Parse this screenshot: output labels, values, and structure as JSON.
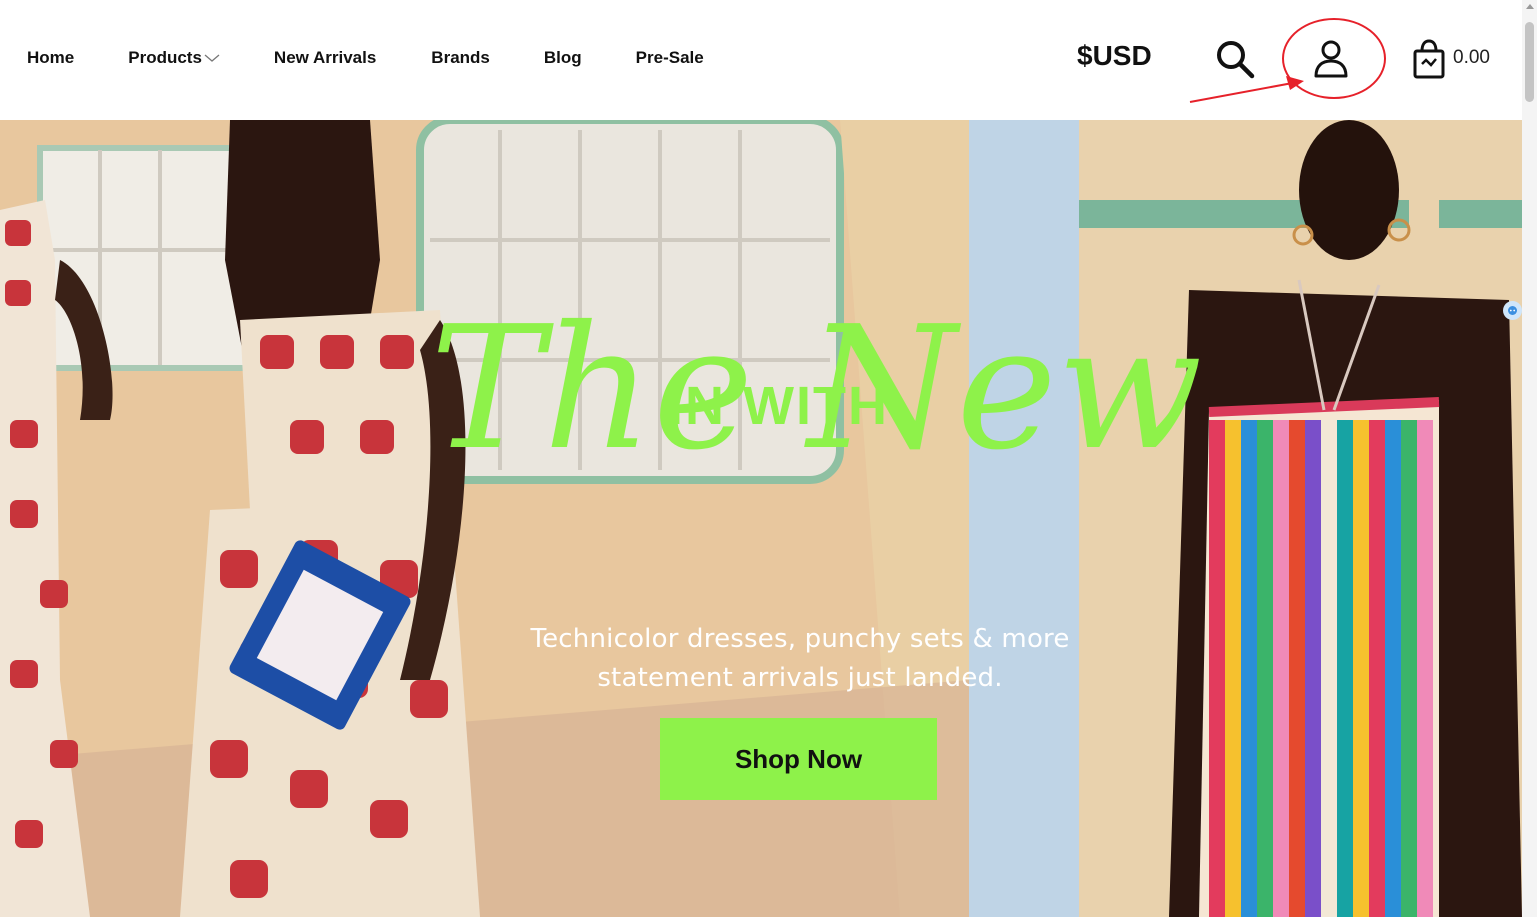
{
  "nav": {
    "items": [
      {
        "label": "Home"
      },
      {
        "label": "Products"
      },
      {
        "label": "New Arrivals"
      },
      {
        "label": "Brands"
      },
      {
        "label": "Blog"
      },
      {
        "label": "Pre-Sale"
      }
    ]
  },
  "header": {
    "currency": "$USD",
    "cart_total": "0.00",
    "icons": [
      "search-icon",
      "account-icon",
      "cart-icon"
    ]
  },
  "hero": {
    "headline_top": "IN WITH",
    "headline_script": "The New",
    "subtitle_line1": "Technicolor dresses, punchy sets & more",
    "subtitle_line2": "statement arrivals just landed.",
    "cta_label": "Shop Now"
  },
  "colors": {
    "accent": "#8ef24a",
    "annotation": "#e6212a"
  }
}
